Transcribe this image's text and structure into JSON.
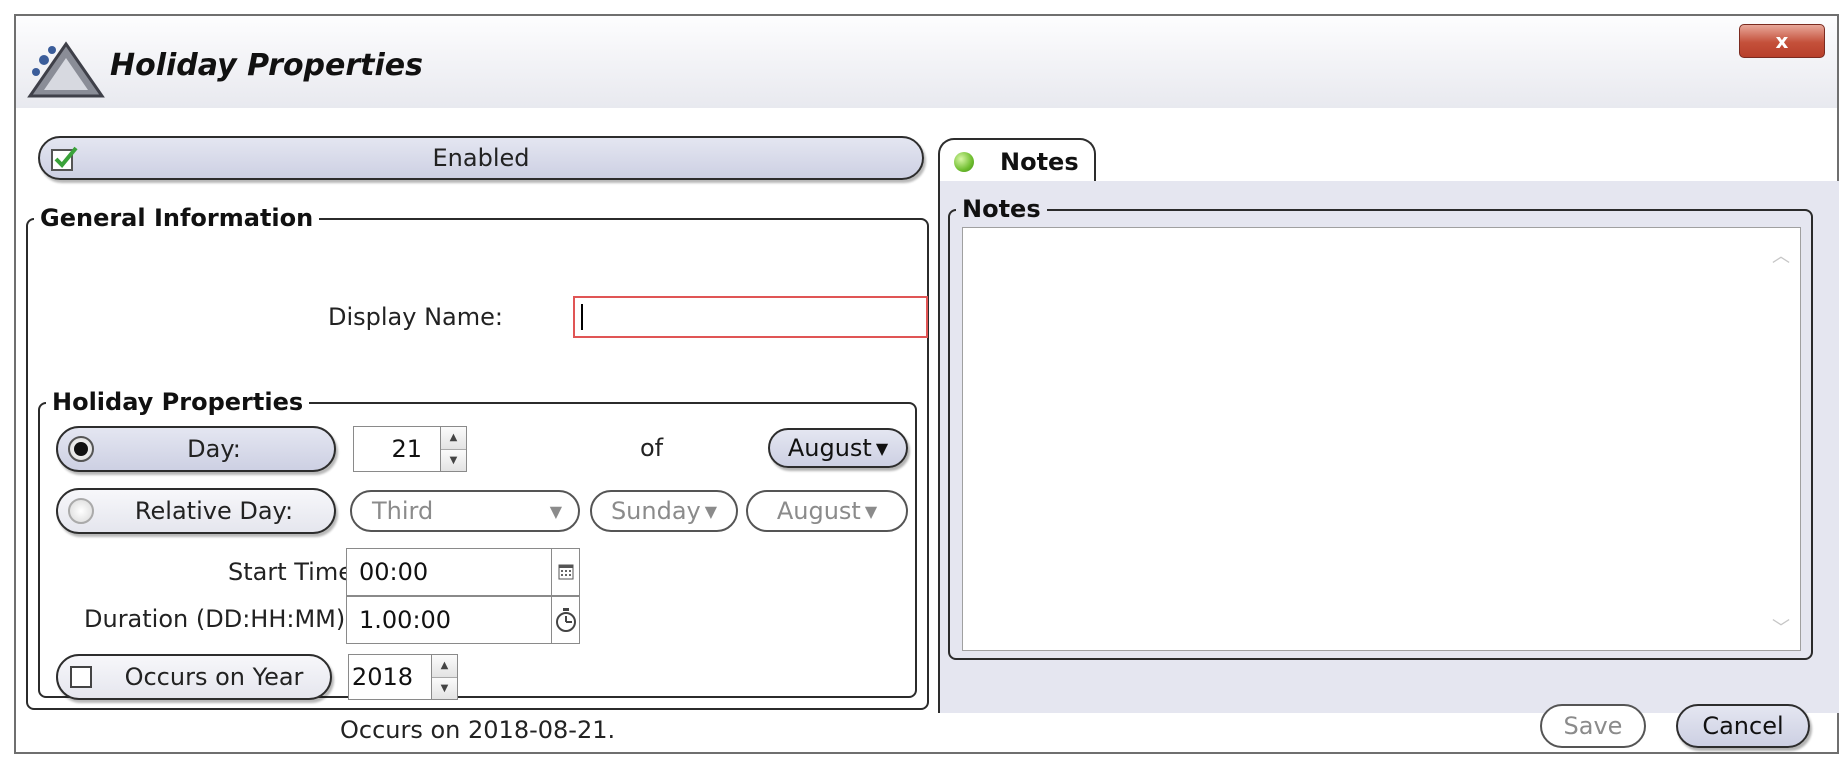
{
  "window": {
    "title": "Holiday Properties",
    "close_label": "x",
    "app_icon": "triangle-logo-icon"
  },
  "enabled": {
    "label": "Enabled",
    "checked": true,
    "icon": "green-check-icon"
  },
  "general": {
    "legend": "General Information",
    "display_name_label": "Display Name:",
    "display_name_value": ""
  },
  "holiday": {
    "legend": "Holiday Properties",
    "day_option": {
      "label": "Day:",
      "selected": true
    },
    "day_value": "21",
    "of_label": "of",
    "day_month": "August",
    "relative_option": {
      "label": "Relative Day:",
      "selected": false
    },
    "relative_ordinal": "Third",
    "relative_weekday": "Sunday",
    "relative_month": "August",
    "start_time_label": "Start Time:",
    "start_time_value": "00:00",
    "duration_label": "Duration (DD:HH:MM)",
    "duration_value": "1.00:00",
    "occurs_year_label": "Occurs on Year",
    "occurs_year_checked": false,
    "year_value": "2018",
    "summary": "Occurs on 2018-08-21."
  },
  "notes": {
    "tab_label": "Notes",
    "tab_status": "green-led-icon",
    "legend": "Notes",
    "text": ""
  },
  "buttons": {
    "save": "Save",
    "cancel": "Cancel"
  },
  "colors": {
    "accent_pill": "#cdd0e3",
    "panel_bg": "#e5e6f0",
    "close_red": "#c4503a",
    "focus_border": "#e05555"
  }
}
